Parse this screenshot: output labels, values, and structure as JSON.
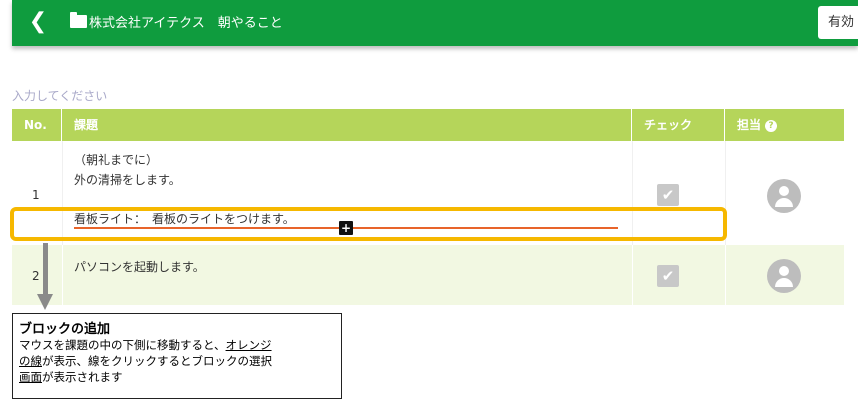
{
  "header": {
    "back_icon": "chevron-left-icon",
    "folder_icon": "folder-icon",
    "title": "株式会社アイテクス　朝やること",
    "valid_button": "有効"
  },
  "input_hint": "入力してください",
  "table": {
    "columns": {
      "no": "No.",
      "task": "課題",
      "check": "チェック",
      "person": "担当"
    },
    "rows": [
      {
        "no": "1",
        "lines": [
          "（朝礼までに）",
          "外の清掃をします。",
          "",
          "看板ライト：　看板のライトをつけます。"
        ],
        "checked": true
      },
      {
        "no": "2",
        "lines": [
          "パソコンを起動します。"
        ],
        "checked": true
      }
    ]
  },
  "colors": {
    "header_green": "#0f9c3e",
    "table_header": "#b5d55a",
    "highlight": "#f6b800",
    "insert_line": "#e8642a"
  },
  "callout": {
    "title": "ブロックの追加",
    "text_1": "マウスを課題の中の下側に移動すると、",
    "text_2": "オレンジ",
    "text_3": "の線",
    "text_4": "が表示、線をクリックするとブロックの選択",
    "text_5": "画面",
    "text_6": "が表示されます"
  }
}
